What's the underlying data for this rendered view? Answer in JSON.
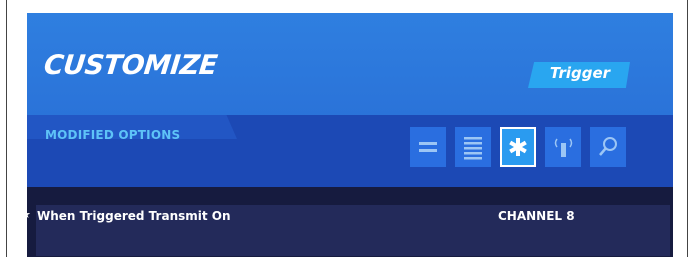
{
  "header": {
    "title": "CUSTOMIZE",
    "tag": "Trigger"
  },
  "section": {
    "label": "MODIFIED OPTIONS"
  },
  "filters": [
    {
      "icon": "list-compact-icon",
      "active": false
    },
    {
      "icon": "list-full-icon",
      "active": false
    },
    {
      "icon": "star-icon",
      "active": true
    },
    {
      "icon": "transmitter-icon",
      "active": false
    },
    {
      "icon": "search-icon",
      "active": false
    }
  ],
  "options": [
    {
      "modified_marker": "★",
      "label": "When Triggered Transmit On",
      "value": "CHANNEL 8"
    }
  ],
  "colors": {
    "header_blue": "#2f7fe0",
    "subheader_blue": "#1c49b5",
    "accent_cyan": "#29a6f0",
    "section_label": "#5ec3f7",
    "list_bg": "#161b3f",
    "row_bg": "#232a5a"
  }
}
